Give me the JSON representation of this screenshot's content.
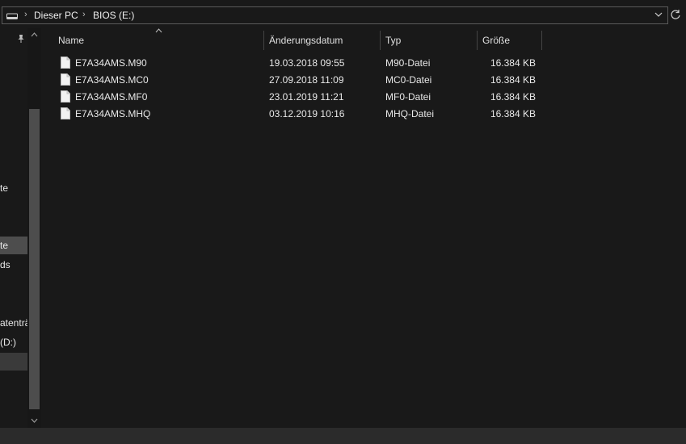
{
  "address": {
    "crumbs": [
      "Dieser PC",
      "BIOS (E:)"
    ]
  },
  "nav": {
    "items": [
      {
        "label": "te"
      },
      {
        "label": "te"
      },
      {
        "label": "ds"
      },
      {
        "label": "atenträ"
      },
      {
        "label": "(D:)"
      },
      {
        "label": ""
      }
    ]
  },
  "columns": {
    "name": "Name",
    "date": "Änderungsdatum",
    "type": "Typ",
    "size": "Größe"
  },
  "files": [
    {
      "name": "E7A34AMS.M90",
      "date": "19.03.2018 09:55",
      "type": "M90-Datei",
      "size": "16.384 KB"
    },
    {
      "name": "E7A34AMS.MC0",
      "date": "27.09.2018 11:09",
      "type": "MC0-Datei",
      "size": "16.384 KB"
    },
    {
      "name": "E7A34AMS.MF0",
      "date": "23.01.2019 11:21",
      "type": "MF0-Datei",
      "size": "16.384 KB"
    },
    {
      "name": "E7A34AMS.MHQ",
      "date": "03.12.2019 10:16",
      "type": "MHQ-Datei",
      "size": "16.384 KB"
    }
  ]
}
